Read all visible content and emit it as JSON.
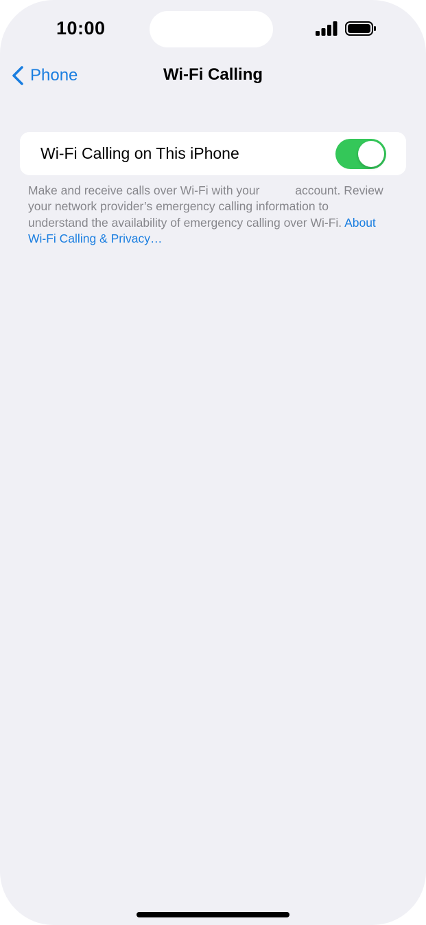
{
  "status_bar": {
    "time": "10:00",
    "icons": [
      "signal-bars-icon",
      "battery-icon"
    ]
  },
  "nav": {
    "back_label": "Phone",
    "back_icon": "chevron-left-icon",
    "title": "Wi-Fi Calling"
  },
  "settings": {
    "wifi_calling": {
      "label": "Wi-Fi Calling on This iPhone",
      "enabled": true
    }
  },
  "footer": {
    "text_part1": "Make and receive calls over Wi-Fi with your",
    "text_part2": "account. Review your network provider’s emergency calling information to understand the availability of emergency calling over Wi-Fi.",
    "link": "About Wi-Fi Calling & Privacy…"
  },
  "colors": {
    "background": "#f0f0f5",
    "accent": "#1a7ee0",
    "toggle_on": "#34c759",
    "footer_text": "#86868b"
  }
}
